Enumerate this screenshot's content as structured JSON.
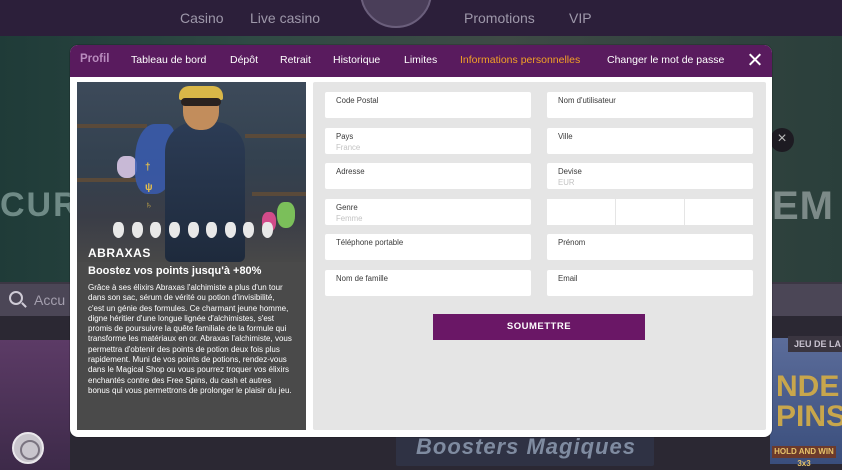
{
  "background": {
    "nav": {
      "casino": "Casino",
      "live_casino": "Live casino",
      "promotions": "Promotions",
      "vip": "VIP"
    },
    "search_placeholder": "Accu",
    "hero_left_text": "CUR",
    "hero_right_text": "EM",
    "banner_text": "Boosters Magiques",
    "game_badge": "JEU DE LA",
    "game_title": "NDE\nPINS",
    "game_sub": "HOLD AND WIN 3x3"
  },
  "tabs": [
    {
      "label": "Profil"
    },
    {
      "label": "Tableau de bord"
    },
    {
      "label": "Dépôt"
    },
    {
      "label": "Retrait"
    },
    {
      "label": "Historique"
    },
    {
      "label": "Limites"
    },
    {
      "label": "Informations personnelles",
      "active": true
    },
    {
      "label": "Changer le mot de passe"
    }
  ],
  "colors": {
    "tabbar_bg": "#591b5e",
    "tab_active": "#f2a126",
    "submit_bg": "#6a1766"
  },
  "promo": {
    "title": "ABRAXAS",
    "subtitle": "Boostez vos points jusqu'à +80%",
    "description": "Grâce à ses élixirs Abraxas l'alchimiste a plus d'un tour dans son sac, sérum de vérité ou potion d'invisibilité, c'est un génie des formules. Ce charmant jeune homme, digne héritier d'une longue lignée d'alchimistes, s'est promis de poursuivre la quête familiale de la formule qui transforme les matériaux en or. Abraxas l'alchimiste, vous permettra d'obtenir des points de potion deux fois plus rapidement. Muni de vos points de potions, rendez-vous dans le Magical Shop ou vous pourrez troquer vos élixirs enchantés contre des Free Spins, du cash et autres bonus qui vous permettrons de prolonger le plaisir du jeu."
  },
  "form": {
    "code_postal": {
      "label": "Code Postal",
      "value": ""
    },
    "nom_utilisateur": {
      "label": "Nom d'utilisateur",
      "value": ""
    },
    "pays": {
      "label": "Pays",
      "value": "France"
    },
    "ville": {
      "label": "Ville",
      "value": ""
    },
    "adresse": {
      "label": "Adresse",
      "value": ""
    },
    "devise": {
      "label": "Devise",
      "value": "EUR"
    },
    "genre": {
      "label": "Genre",
      "value": "Femme"
    },
    "telephone": {
      "label": "Téléphone portable",
      "value": ""
    },
    "prenom": {
      "label": "Prénom",
      "value": ""
    },
    "nom_famille": {
      "label": "Nom de famille",
      "value": ""
    },
    "email": {
      "label": "Email",
      "value": ""
    },
    "submit_label": "SOUMETTRE"
  }
}
